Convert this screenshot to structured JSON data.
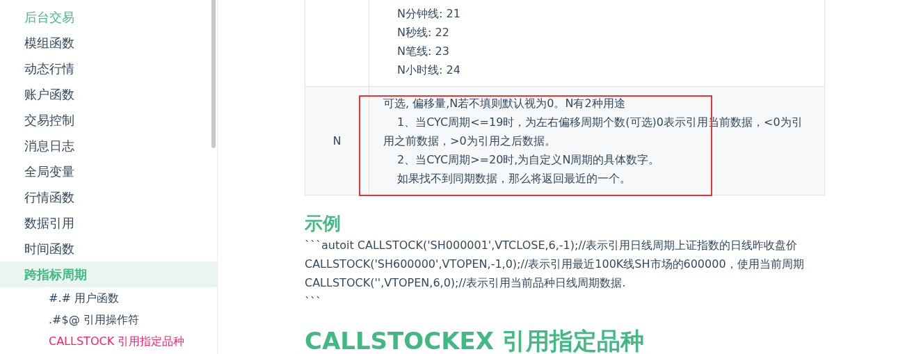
{
  "sidebar": {
    "items": [
      {
        "label": "后台交易",
        "selected": false,
        "kind": "visited"
      },
      {
        "label": "模组函数",
        "selected": false,
        "kind": "plain"
      },
      {
        "label": "动态行情",
        "selected": false,
        "kind": "plain"
      },
      {
        "label": "账户函数",
        "selected": false,
        "kind": "plain"
      },
      {
        "label": "交易控制",
        "selected": false,
        "kind": "plain"
      },
      {
        "label": "消息日志",
        "selected": false,
        "kind": "plain"
      },
      {
        "label": "全局变量",
        "selected": false,
        "kind": "plain"
      },
      {
        "label": "行情函数",
        "selected": false,
        "kind": "plain"
      },
      {
        "label": "数据引用",
        "selected": false,
        "kind": "plain"
      },
      {
        "label": "时间函数",
        "selected": false,
        "kind": "plain"
      },
      {
        "label": "跨指标周期",
        "selected": true,
        "children": [
          {
            "label": "#.# 用户函数",
            "selected": false
          },
          {
            "label": ".#$@ 引用操作符",
            "selected": false
          },
          {
            "label": "CALLSTOCK 引用指定品种",
            "selected": true
          }
        ]
      }
    ]
  },
  "table": {
    "rows": [
      {
        "param": "",
        "description": [
          {
            "text": "N分钟线: 21",
            "indent": true
          },
          {
            "text": "N秒线: 22",
            "indent": true
          },
          {
            "text": "N笔线: 23",
            "indent": true
          },
          {
            "text": "N小时线: 24",
            "indent": true
          }
        ],
        "highlighted": false
      },
      {
        "param": "N",
        "description": [
          {
            "text": "可选, 偏移量,N若不填则默认视为0。N有2种用途",
            "indent": false
          },
          {
            "text": "1、当CYC周期<=19时，为左右偏移周期个数(可选)0表示引用当前数据，<0为引用之前数据，>0为引用之后数据。",
            "indent": true
          },
          {
            "text": "2、当CYC周期>=20时,为自定义N周期的具体数字。",
            "indent": true
          },
          {
            "text": "如果找不到同期数据，那么将返回最近的一个。",
            "indent": true
          }
        ],
        "highlighted": true
      }
    ]
  },
  "example": {
    "heading": "示例",
    "text": "```autoit CALLSTOCK('SH000001',VTCLOSE,6,-1);//表示引用日线周期上证指数的日线昨收盘价 CALLSTOCK('SH600000',VTOPEN,-1,0);//表示引用最近100K线SH市场的600000，使用当前周期 CALLSTOCK('',VTOPEN,6,0);//表示引用当前品种日线周期数据.\n```"
  },
  "next_section": {
    "heading": "CALLSTOCKEX 引用指定品种"
  }
}
